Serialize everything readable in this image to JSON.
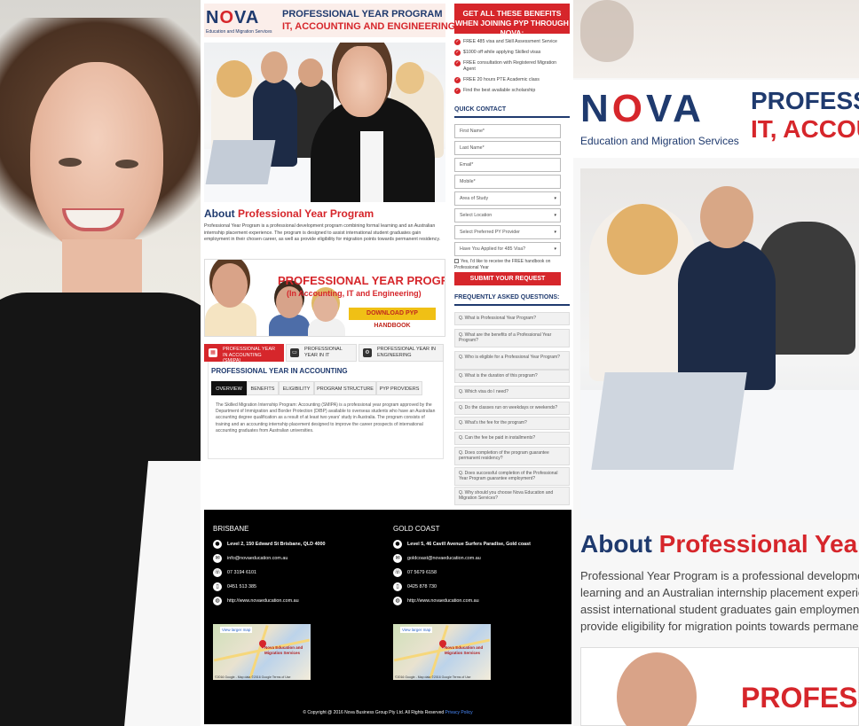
{
  "brand": {
    "logo_word_pre": "N",
    "logo_word_o": "O",
    "logo_word_post": "VA",
    "logo_sub": "Education and Migration Services"
  },
  "header": {
    "title_line1": "PROFESSIONAL YEAR PROGRAM",
    "title_line2": "IT, ACCOUNTING AND ENGINEERING"
  },
  "about": {
    "heading_prefix": "About",
    "heading_highlight": "Professional Year Program",
    "text": "Professional Year Program is a professional development program combining formal learning and an Australian internship placement experience. The program is designed to assist international student graduates gain employment in their chosen career, as well as provide eligibility for migration points towards permanent residency."
  },
  "banner": {
    "title": "PROFESSIONAL YEAR PROGRAM",
    "subtitle": "(In Accounting, IT and Engineering)",
    "button": "DOWNLOAD PYP HANDBOOK"
  },
  "program_tabs": [
    {
      "label": "PROFESSIONAL YEAR IN ACCOUNTING (SMIPA)",
      "icon": "calculator-icon",
      "glyph": "▦",
      "active": true
    },
    {
      "label": "PROFESSIONAL YEAR IN IT",
      "icon": "monitor-icon",
      "glyph": "▭",
      "active": false
    },
    {
      "label": "PROFESSIONAL YEAR IN ENGINEERING",
      "icon": "gear-icon",
      "glyph": "⚙",
      "active": false
    }
  ],
  "panel": {
    "title": "PROFESSIONAL YEAR IN ACCOUNTING",
    "subtabs": [
      "OVERVIEW",
      "BENEFITS",
      "ELIGIBILITY",
      "PROGRAM STRUCTURE",
      "PYP PROVIDERS"
    ],
    "active_subtab": "OVERVIEW",
    "text": "The Skilled Migration Internship Program: Accounting (SMIPA) is a professional year program approved by the Department of Immigration and Border Protection (DIBP) available to overseas students who have an Australian accounting degree qualification as a result of at least two years' study in Australia. The program consists of training and an accounting internship placement designed to improve the career prospects of international accounting graduates from Australian universities."
  },
  "sidebar": {
    "benefits_title": "GET ALL THESE BENEFITS WHEN JOINING PYP THROUGH NOVA:",
    "benefits": [
      "FREE 485 visa and Skill Assessment Service",
      "$1000 off while applying Skilled visas",
      "FREE consultation with Registered Migration Agent",
      "FREE 20 hours PTE Academic class",
      "Find the best available scholarship"
    ],
    "contact_title": "QUICK CONTACT",
    "fields": [
      {
        "placeholder": "First Name*",
        "type": "text"
      },
      {
        "placeholder": "Last Name*",
        "type": "text"
      },
      {
        "placeholder": "Email*",
        "type": "text"
      },
      {
        "placeholder": "Mobile*",
        "type": "text"
      },
      {
        "placeholder": "Area of Study",
        "type": "select"
      },
      {
        "placeholder": "Select Location",
        "type": "select"
      },
      {
        "placeholder": "Select Preferred PY Provider",
        "type": "select"
      },
      {
        "placeholder": "Have You Applied for 485 Visa?",
        "type": "select"
      }
    ],
    "handbook_checkbox": "Yes, I'd like to receive the FREE handbook on Professional Year",
    "submit": "SUBMIT YOUR REQUEST",
    "faq_title": "FREQUENTLY ASKED QUESTIONS:",
    "faqs": [
      "Q. What is Professional Year Program?",
      "Q. What are the benefits of a Professional Year Program?",
      "Q. Who is eligible for a Professional Year Program?",
      "Q. What is the duration of this program?",
      "Q. Which visa do I need?",
      "Q. Do the classes run on weekdays or weekends?",
      "Q. What's the fee for the program?",
      "Q. Can the fee be paid in installments?",
      "Q. Does completion of the program guarantee permanent residency?",
      "Q. Does successful completion of the Professional Year Program guarantee employment?",
      "Q. Why should you choose Nova Education and Migration Services?"
    ]
  },
  "footer": {
    "offices": [
      {
        "city": "BRISBANE",
        "address": "Level 2, 150 Edward St Brisbane, QLD 4000",
        "email": "info@novaeducation.com.au",
        "phone": "07 3194 6101",
        "mobile": "0451 513 385",
        "web": "http://www.novaeducation.com.au"
      },
      {
        "city": "GOLD COAST",
        "address": "Level 5, 46 Cavill Avenue Surfers Paradise, Gold coast",
        "email": "goldcoast@novaeducation.com.au",
        "phone": "07 5679 6158",
        "mobile": "0425 878 730",
        "web": "http://www.novaeducation.com.au"
      }
    ],
    "map": {
      "view_larger": "View larger map",
      "label": "Nova Education and Migration Services",
      "credit": "©2016 Google - Map data ©2016 Google   Terms of Use"
    },
    "copyright": "© Copyright @ 2016 Nova Business Group Pty Ltd. All Rights Reserved",
    "privacy": "Privacy Policy"
  },
  "colors": {
    "brand_navy": "#1f3a6e",
    "brand_red": "#d6262b",
    "cta_yellow": "#f0c015",
    "footer_bg": "#000000"
  }
}
